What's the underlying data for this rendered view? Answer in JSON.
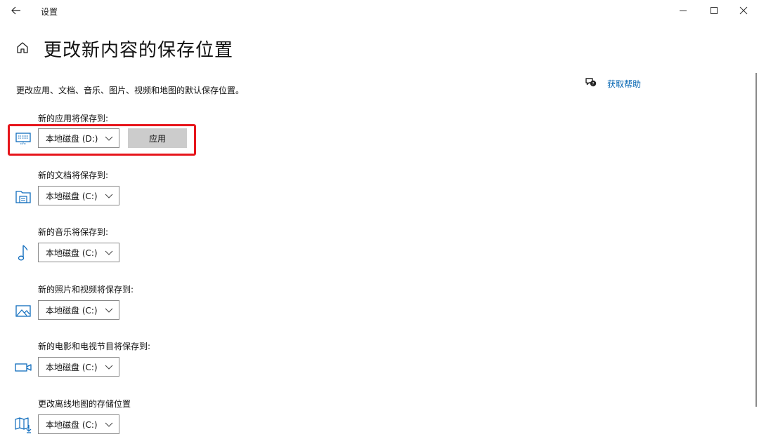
{
  "window": {
    "title": "设置"
  },
  "page": {
    "title": "更改新内容的保存位置",
    "description": "更改应用、文档、音乐、图片、视频和地图的默认保存位置。",
    "help_label": "获取帮助"
  },
  "sections": [
    {
      "label": "新的应用将保存到:",
      "value": "本地磁盘 (D:)",
      "icon": "apps-monitor-icon",
      "apply_label": "应用"
    },
    {
      "label": "新的文档将保存到:",
      "value": "本地磁盘 (C:)",
      "icon": "documents-icon"
    },
    {
      "label": "新的音乐将保存到:",
      "value": "本地磁盘 (C:)",
      "icon": "music-note-icon"
    },
    {
      "label": "新的照片和视频将保存到:",
      "value": "本地磁盘 (C:)",
      "icon": "photo-icon"
    },
    {
      "label": "新的电影和电视节目将保存到:",
      "value": "本地磁盘 (C:)",
      "icon": "video-camera-icon"
    },
    {
      "label": "更改离线地图的存储位置",
      "value": "本地磁盘 (C:)",
      "icon": "map-icon"
    }
  ],
  "colors": {
    "highlight": "#e6151b",
    "link": "#0063b1",
    "apply_button": "#cccccc"
  }
}
